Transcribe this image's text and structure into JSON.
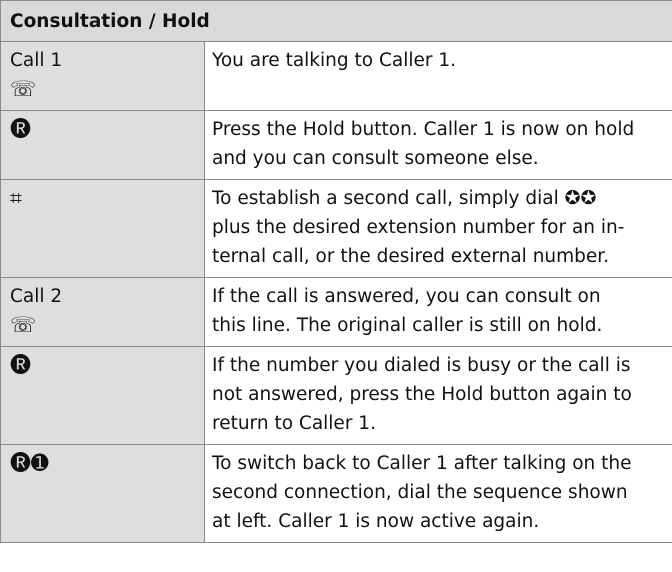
{
  "table": {
    "heading": "Consultation / Hold",
    "rows": [
      {
        "key_text": "Call 1",
        "key_icon": "☏",
        "key_icon_name": "handset-icon",
        "desc_lines": [
          "You are talking to Caller 1."
        ]
      },
      {
        "key_text": "",
        "key_icon": "🅡",
        "key_icon_name": "hold-key-icon",
        "desc_lines": [
          "Press the Hold button. Caller 1 is now on hold",
          "and you can consult someone else."
        ]
      },
      {
        "key_text": "",
        "key_icon": "⌗",
        "key_icon_name": "keypad-icon",
        "desc_before": "To establish a second call, simply dial ",
        "desc_glyphs": "✪✪",
        "desc_after": "",
        "desc_lines": [
          "plus the desired extension number for an in-",
          "ternal call, or the desired external number."
        ]
      },
      {
        "key_text": "Call 2",
        "key_icon": "☏",
        "key_icon_name": "handset-icon",
        "desc_lines": [
          "If the call is answered, you can consult on",
          "this line. The original caller is still on hold."
        ]
      },
      {
        "key_text": "",
        "key_icon": "🅡",
        "key_icon_name": "hold-key-icon",
        "desc_lines": [
          "If the number you dialed is busy or the call is",
          "not answered, press the Hold button again to",
          "return to Caller 1."
        ]
      },
      {
        "key_text": "",
        "key_icon": "🅡➊",
        "key_icon_name": "hold-and-one-keys-icon",
        "desc_lines": [
          "To switch back to Caller 1 after talking on the",
          "second connection, dial the sequence shown",
          "at left. Caller 1 is now active again."
        ]
      }
    ]
  }
}
